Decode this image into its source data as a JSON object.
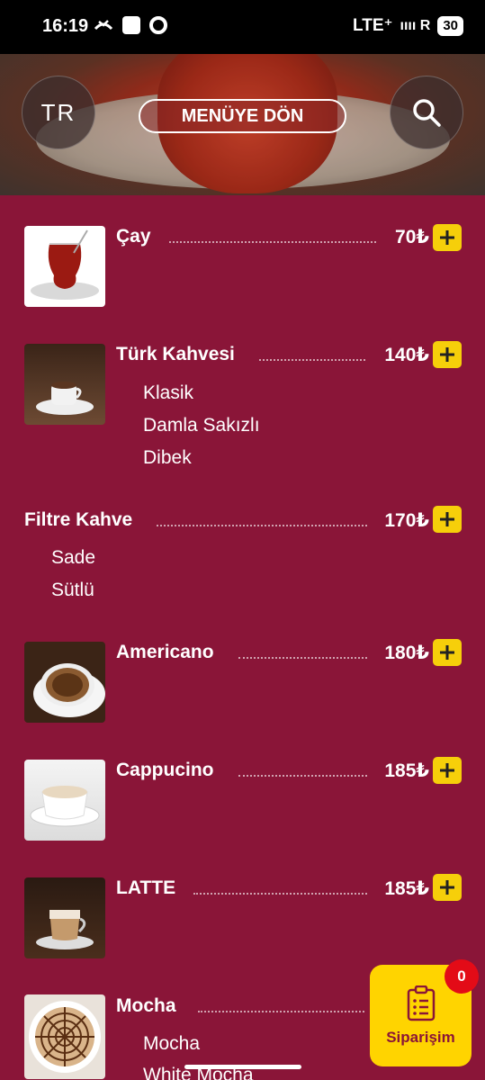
{
  "status_bar": {
    "time": "16:19",
    "network": "LTE⁺",
    "signal": "ıııı R",
    "battery": "30"
  },
  "header": {
    "lang": "TR",
    "back_label": "MENÜYE DÖN"
  },
  "currency": "₺",
  "items": [
    {
      "name": "Çay",
      "price": "70₺",
      "thumb": "tea-glass-image",
      "options": []
    },
    {
      "name": "Türk Kahvesi",
      "price": "140₺",
      "thumb": "turkish-coffee-image",
      "options": [
        "Klasik",
        "Damla Sakızlı",
        "Dibek"
      ]
    },
    {
      "name": "Filtre Kahve",
      "price": "170₺",
      "thumb": null,
      "options": [
        "Sade",
        "Sütlü"
      ]
    },
    {
      "name": "Americano",
      "price": "180₺",
      "thumb": "americano-image",
      "options": []
    },
    {
      "name": "Cappucino",
      "price": "185₺",
      "thumb": "cappucino-image",
      "options": []
    },
    {
      "name": "LATTE",
      "price": "185₺",
      "thumb": "latte-image",
      "options": []
    },
    {
      "name": "Mocha",
      "price": "",
      "thumb": "mocha-image",
      "options": [
        "Mocha",
        "White Mocha"
      ]
    }
  ],
  "order": {
    "label": "Siparişim",
    "count": "0"
  },
  "colors": {
    "background": "#8a1538",
    "accent": "#f6cf0a",
    "badge": "#e30b17"
  }
}
